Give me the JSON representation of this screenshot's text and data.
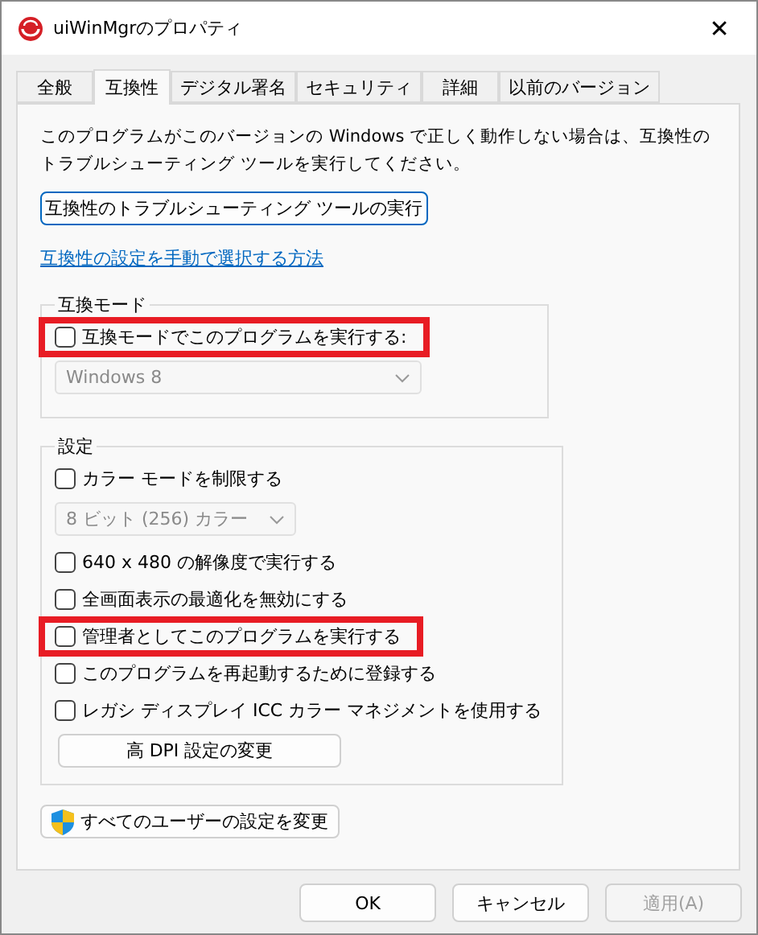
{
  "window": {
    "title": "uiWinMgrのプロパティ",
    "close": "✕"
  },
  "tabs": [
    {
      "label": "全般",
      "selected": false
    },
    {
      "label": "互換性",
      "selected": true
    },
    {
      "label": "デジタル署名",
      "selected": false
    },
    {
      "label": "セキュリティ",
      "selected": false
    },
    {
      "label": "詳細",
      "selected": false
    },
    {
      "label": "以前のバージョン",
      "selected": false
    }
  ],
  "description": "このプログラムがこのバージョンの Windows で正しく動作しない場合は、互換性のトラブルシューティング ツールを実行してください。",
  "troubleshoot_button": "互換性のトラブルシューティング ツールの実行",
  "help_link": "互換性の設定を手動で選択する方法",
  "compat_group": {
    "title": "互換モード",
    "items": [
      {
        "kind": "checkbox",
        "label": "互換モードでこのプログラムを実行する:",
        "checked": false,
        "highlighted": true
      },
      {
        "kind": "dropdown",
        "value": "Windows 8",
        "disabled": true
      }
    ]
  },
  "settings_group": {
    "title": "設定",
    "items": [
      {
        "kind": "checkbox",
        "label": "カラー モードを制限する",
        "checked": false,
        "highlighted": false
      },
      {
        "kind": "dropdown",
        "value": "8 ビット (256) カラー",
        "disabled": true
      },
      {
        "kind": "checkbox",
        "label": "640 x 480 の解像度で実行する",
        "checked": false,
        "highlighted": false
      },
      {
        "kind": "checkbox",
        "label": "全画面表示の最適化を無効にする",
        "checked": false,
        "highlighted": false
      },
      {
        "kind": "checkbox",
        "label": "管理者としてこのプログラムを実行する",
        "checked": false,
        "highlighted": true
      },
      {
        "kind": "checkbox",
        "label": "このプログラムを再起動するために登録する",
        "checked": false,
        "highlighted": false
      },
      {
        "kind": "checkbox",
        "label": "レガシ ディスプレイ ICC カラー マネジメントを使用する",
        "checked": false,
        "highlighted": false
      },
      {
        "kind": "button",
        "label": "高 DPI 設定の変更"
      }
    ]
  },
  "all_users_button": "すべてのユーザーの設定を変更",
  "footer_buttons": [
    {
      "label": "OK",
      "disabled": false
    },
    {
      "label": "キャンセル",
      "disabled": false
    },
    {
      "label": "適用(A)",
      "disabled": true
    }
  ]
}
